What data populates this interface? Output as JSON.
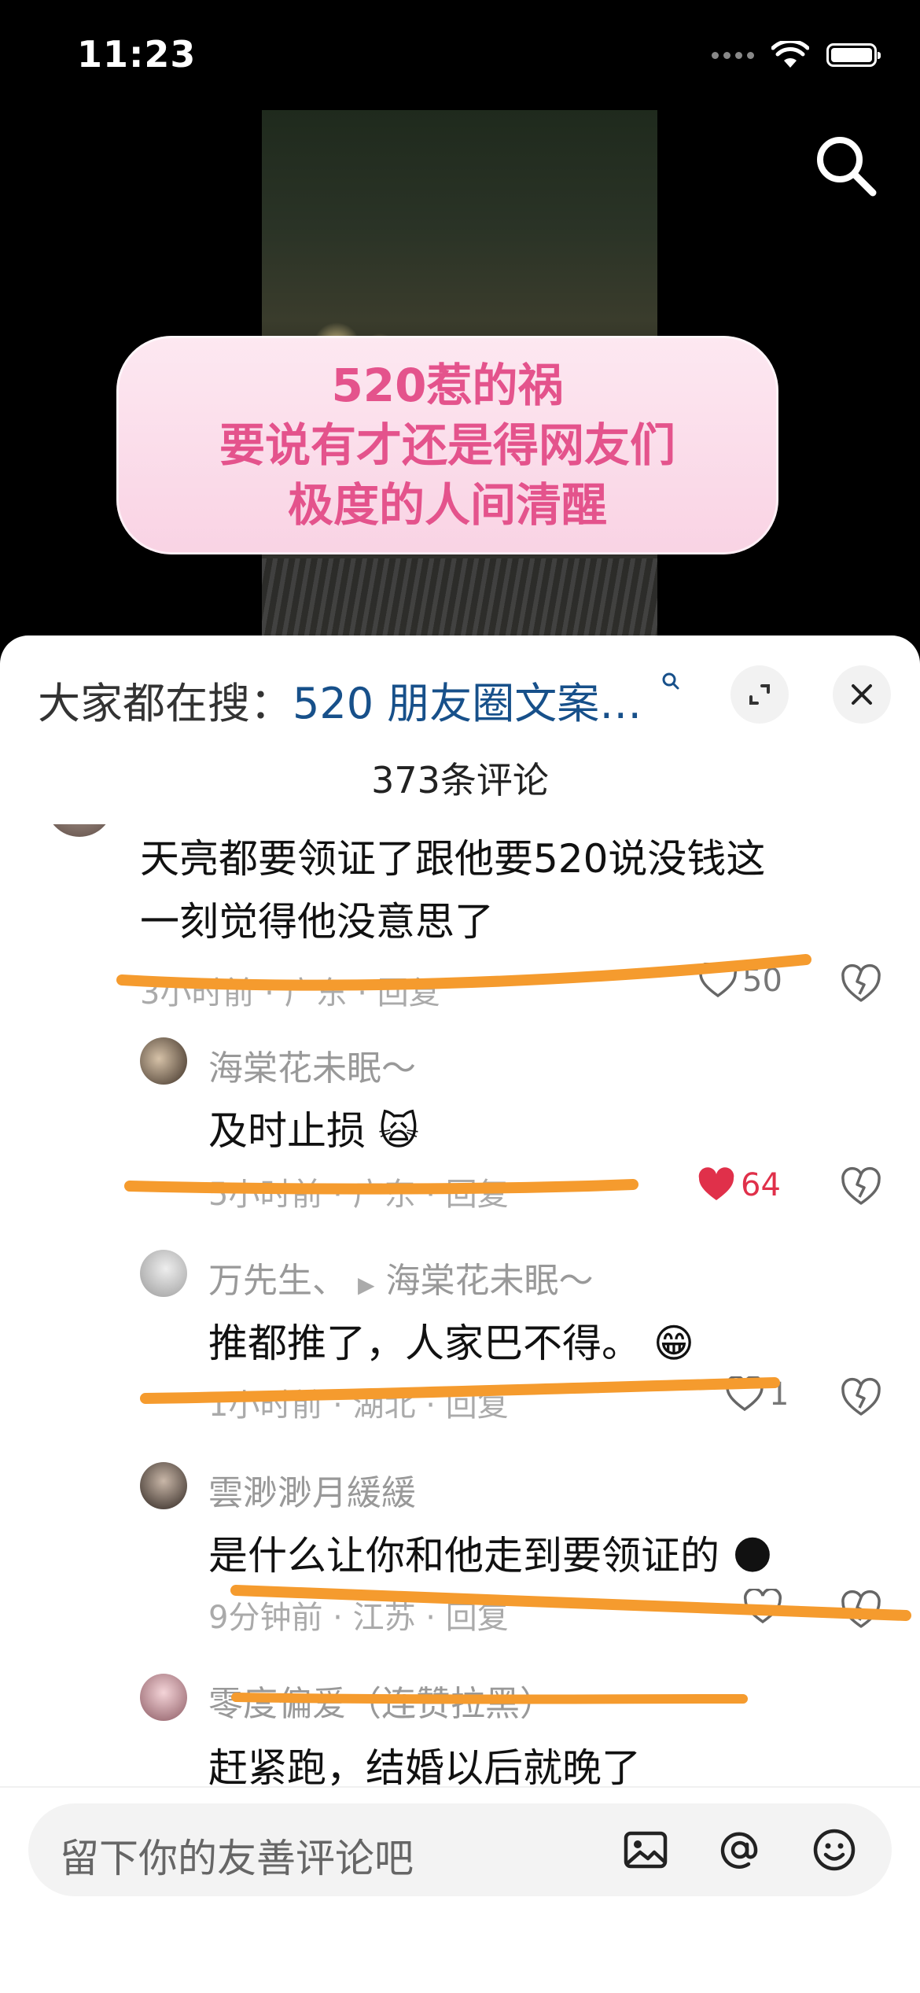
{
  "status_bar": {
    "time": "11:23"
  },
  "video": {
    "caption_lines": [
      "520惹的祸",
      "要说有才还是得网友们",
      "极度的人间清醒"
    ]
  },
  "panel": {
    "suggest_prefix": "大家都在搜：",
    "suggest_link": "520 朋友圈文案…",
    "comment_count": "373条评论"
  },
  "comments": [
    {
      "text_lines": [
        "天亮都要领证了跟他要520说没钱这",
        "一刻觉得他没意思了"
      ],
      "meta": "3小时前 · 广东 · 回复",
      "likes": "50",
      "liked": false
    },
    {
      "user": "海棠花未眠～",
      "text": "及时止损",
      "emoji": "🙀",
      "meta": "5小时前 · 广东 · 回复",
      "likes": "64",
      "liked": true
    },
    {
      "user": "万先生、",
      "reply_to": "海棠花未眠～",
      "text": "推都推了，人家巴不得。",
      "emoji": "😁",
      "meta": "1小时前 · 湖北 · 回复",
      "likes": "1",
      "liked": false
    },
    {
      "user": "雲渺渺月緩緩",
      "text": "是什么让你和他走到要领证的",
      "emoji": "🌑",
      "meta": "9分钟前 · 江苏 · 回复",
      "likes": "",
      "liked": false
    },
    {
      "user": "零度偏爱（连赞拉黑）",
      "text": "赶紧跑，结婚以后就晚了"
    }
  ],
  "input": {
    "placeholder": "留下你的友善评论吧"
  },
  "colors": {
    "caption_text": "#e4538c",
    "caption_bg": "#fde8f1",
    "link": "#17508a",
    "like_active": "#e0304a",
    "scribble": "#f59b2e"
  }
}
